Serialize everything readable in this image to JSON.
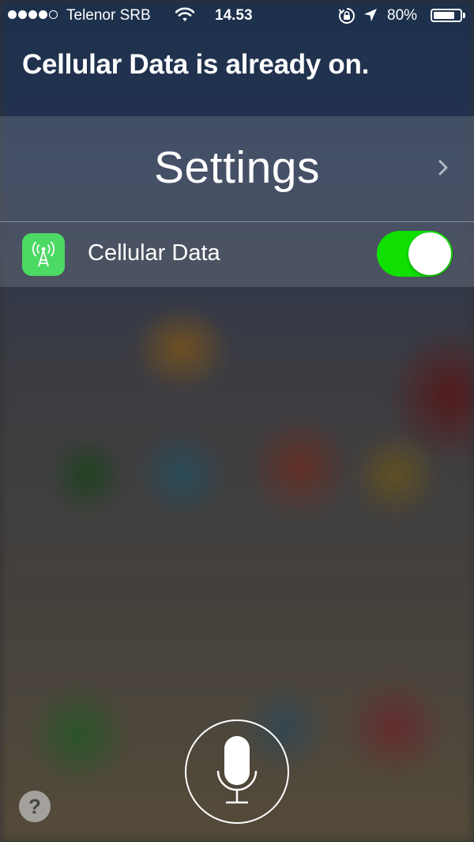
{
  "status_bar": {
    "signal_bars_filled": 4,
    "signal_bars_total": 5,
    "carrier": "Telenor SRB",
    "wifi_icon": "wifi-icon",
    "time": "14.53",
    "rotation_lock_icon": "rotation-lock-icon",
    "location_icon": "location-arrow-icon",
    "battery_percent": "80%",
    "battery_level": 0.8
  },
  "siri": {
    "response": "Cellular Data is already on."
  },
  "card": {
    "title": "Settings",
    "chevron_icon": "chevron-right-icon",
    "row": {
      "icon": "cellular-antenna-icon",
      "icon_color": "#4cd964",
      "label": "Cellular Data",
      "toggle_on": true,
      "toggle_color": "#0fe000"
    }
  },
  "controls": {
    "mic_icon": "microphone-icon",
    "help_label": "?"
  }
}
